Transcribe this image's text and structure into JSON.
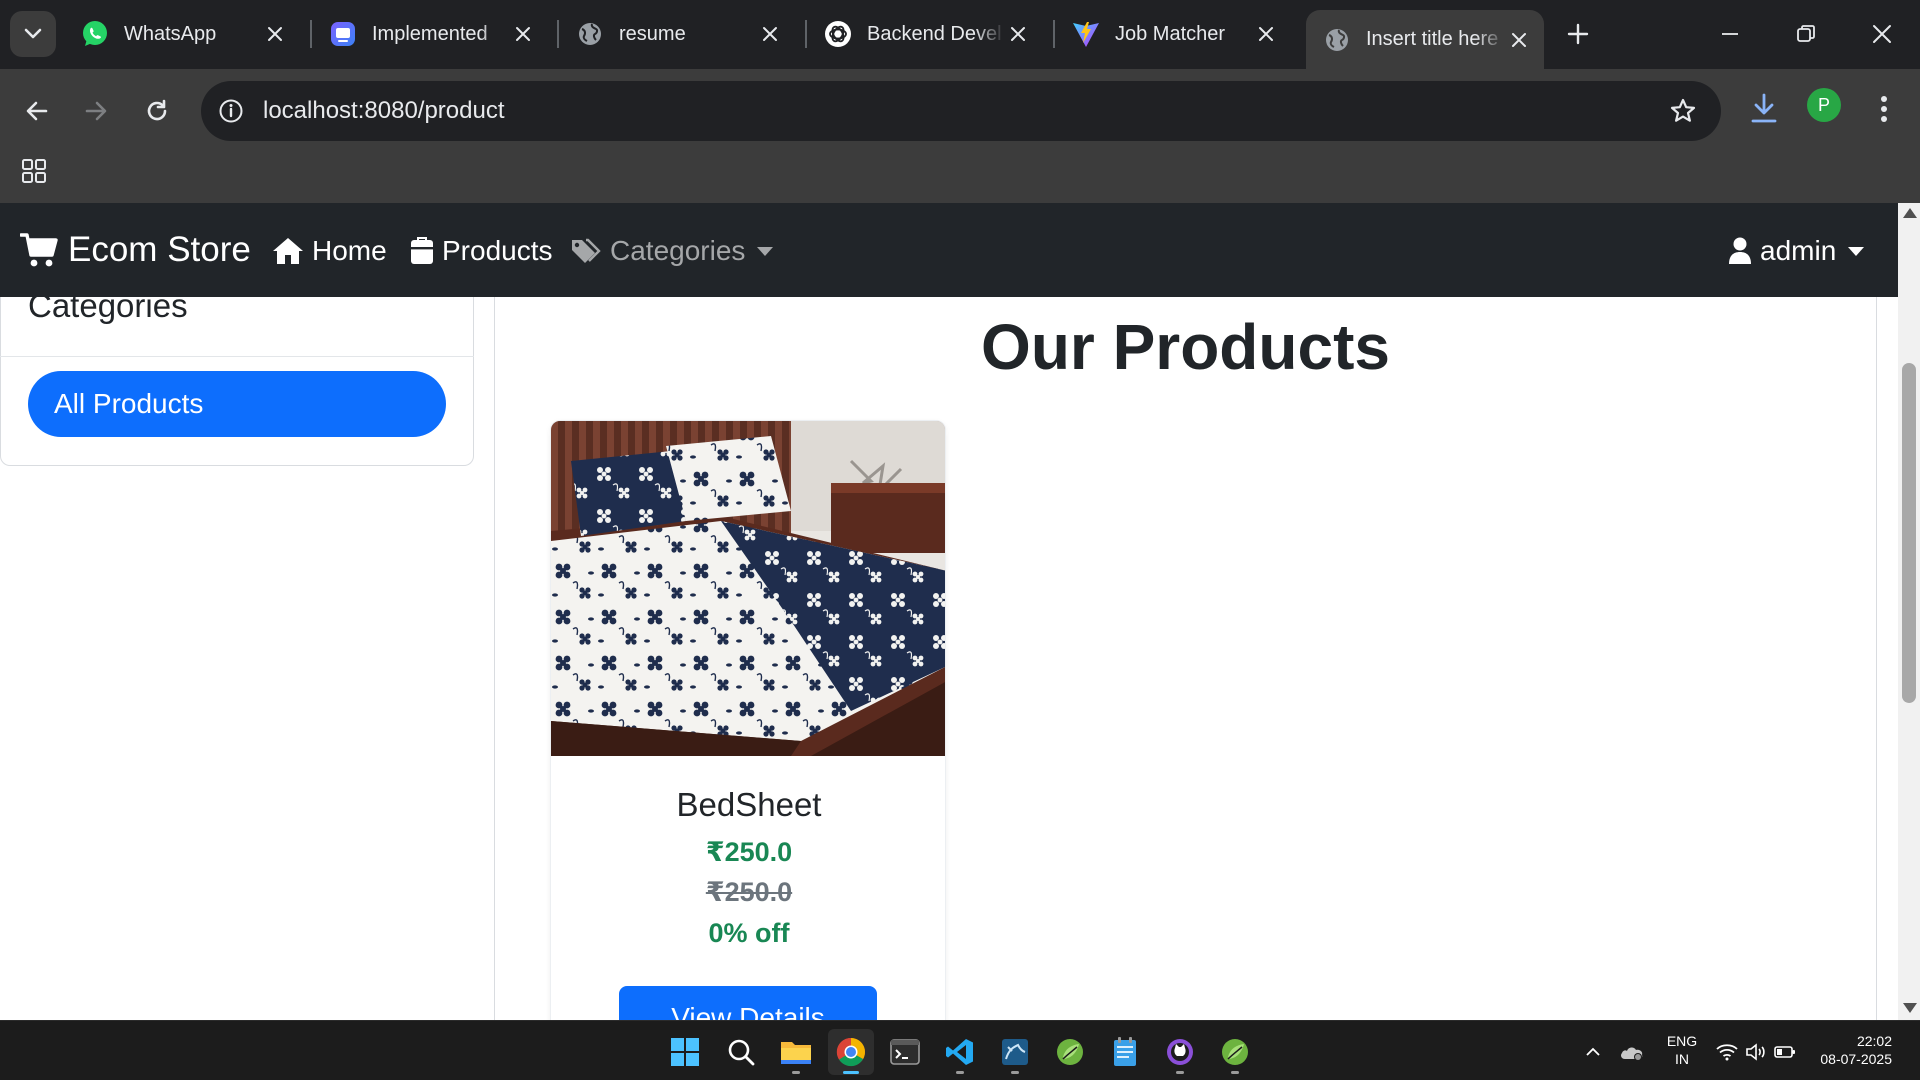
{
  "browser": {
    "tabs": [
      {
        "title": "WhatsApp",
        "icon": "whatsapp-icon",
        "active": false
      },
      {
        "title": "Implemented",
        "icon": "app-icon",
        "active": false
      },
      {
        "title": "resume",
        "icon": "globe-icon",
        "active": false
      },
      {
        "title": "Backend Devel",
        "icon": "openai-icon",
        "active": false
      },
      {
        "title": "Job Matcher",
        "icon": "vite-icon",
        "active": false
      },
      {
        "title": "Insert title here",
        "icon": "globe-icon",
        "active": true
      }
    ],
    "url_host": "localhost",
    "url_rest": ":8080/product",
    "profile_initial": "P"
  },
  "navbar": {
    "brand": "Ecom Store",
    "links": [
      "Home",
      "Products",
      "Categories"
    ],
    "user": "admin"
  },
  "sidebar": {
    "title": "Categories",
    "items": [
      "All Products"
    ]
  },
  "main": {
    "heading": "Our Products",
    "products": [
      {
        "name": "BedSheet",
        "price": "₹250.0",
        "original_price": "₹250.0",
        "discount": "0% off",
        "button": "View Details"
      }
    ]
  },
  "taskbar": {
    "lang_1": "ENG",
    "lang_2": "IN",
    "time": "22:02",
    "date": "08-07-2025"
  },
  "colors": {
    "primary": "#0d6efd",
    "success": "#198754",
    "navbar_bg": "#212529",
    "browser_dark": "#202124"
  }
}
